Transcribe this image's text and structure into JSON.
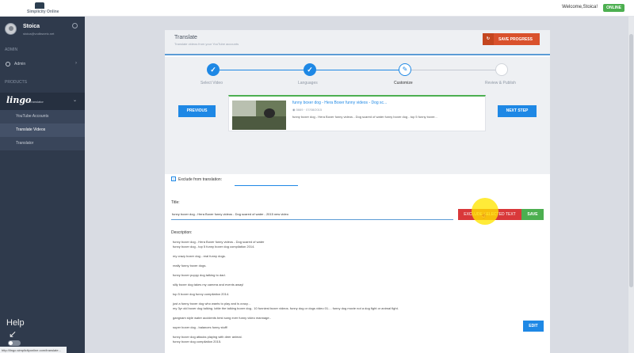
{
  "topbar": {
    "logo_text": "Simplicity Online",
    "welcome": "Welcome,Stoica!",
    "status": "ONLINE"
  },
  "sidebar": {
    "user_name": "Stoica",
    "user_email": "stoica@vodbsnetc.net",
    "section_admin": "ADMIN",
    "admin_label": "Admin",
    "section_products": "PRODUCTS",
    "lingo_brand": "lingo",
    "lingo_sub": "Translator",
    "items": [
      {
        "label": "YouTube Accounts"
      },
      {
        "label": "Translate Videos"
      },
      {
        "label": "Translator"
      }
    ],
    "help": "Help",
    "toggle": "Off",
    "status_url": "http://lingo.simplicityonline.com/translate..."
  },
  "panel": {
    "title": "Translate",
    "subtitle": "Translate videos from your YouTube accounts",
    "save_progress": "SAVE PROGRESS"
  },
  "stepper": {
    "steps": [
      {
        "label": "Select Video",
        "state": "done"
      },
      {
        "label": "Languages",
        "state": "done"
      },
      {
        "label": "Customize",
        "state": "current"
      },
      {
        "label": "Review & Publish",
        "state": "todo"
      }
    ],
    "prev": "PREVIOUS",
    "next": "NEXT STEP"
  },
  "video": {
    "title": "funny boxer dog - Hera Boxer funny videos - Dog sc...",
    "views": "5669",
    "date": "07/08/2015",
    "description": "funny boxer dog - Hera Boxer funny videos - Dog scared of water funny boxer dog - top 5 funny boxer..."
  },
  "form": {
    "exclude_label": "Exclude from translation:",
    "title_label": "Title:",
    "title_value": "funny boxer dog - Hera Boxer funny videos - Dog scared of water - 2015 new video",
    "exclude_button": "EXCLUDE SELECTED TEXT",
    "save_button": "SAVE",
    "description_label": "Description:",
    "description_lines": [
      "funny boxer dog - Hera Boxer funny videos - Dog scared of water",
      "funny boxer dog - top 5 funny boxer dog compilation 2014.",
      "",
      "my crazy boxer dog - real funny dogs.",
      "",
      "really funny boxer dogs.",
      "",
      "funny boxer puppy dog talking to dad.",
      "",
      "silly boxer dog takes my camera and events away!",
      "",
      "top 5 boxer dog funny compilation 2014.",
      "",
      "just a funny boxer dog who wants to play and is crazy...",
      "my 3yr old boxer dog talking. lottie the talking boxer dog.. 10 funniest boxer videos. funny dog or dogs video 01.... funny dog movie not a dog fight or animal fight.",
      "",
      "gangnam style water accidents best song ever funny video mannage..",
      "",
      "super boxer dog - balances funny stuff!",
      "",
      "funny boxer dog attacks playing with deer animal.",
      "funny boxer dog compilation 2015."
    ],
    "edit_button": "EDIT"
  }
}
